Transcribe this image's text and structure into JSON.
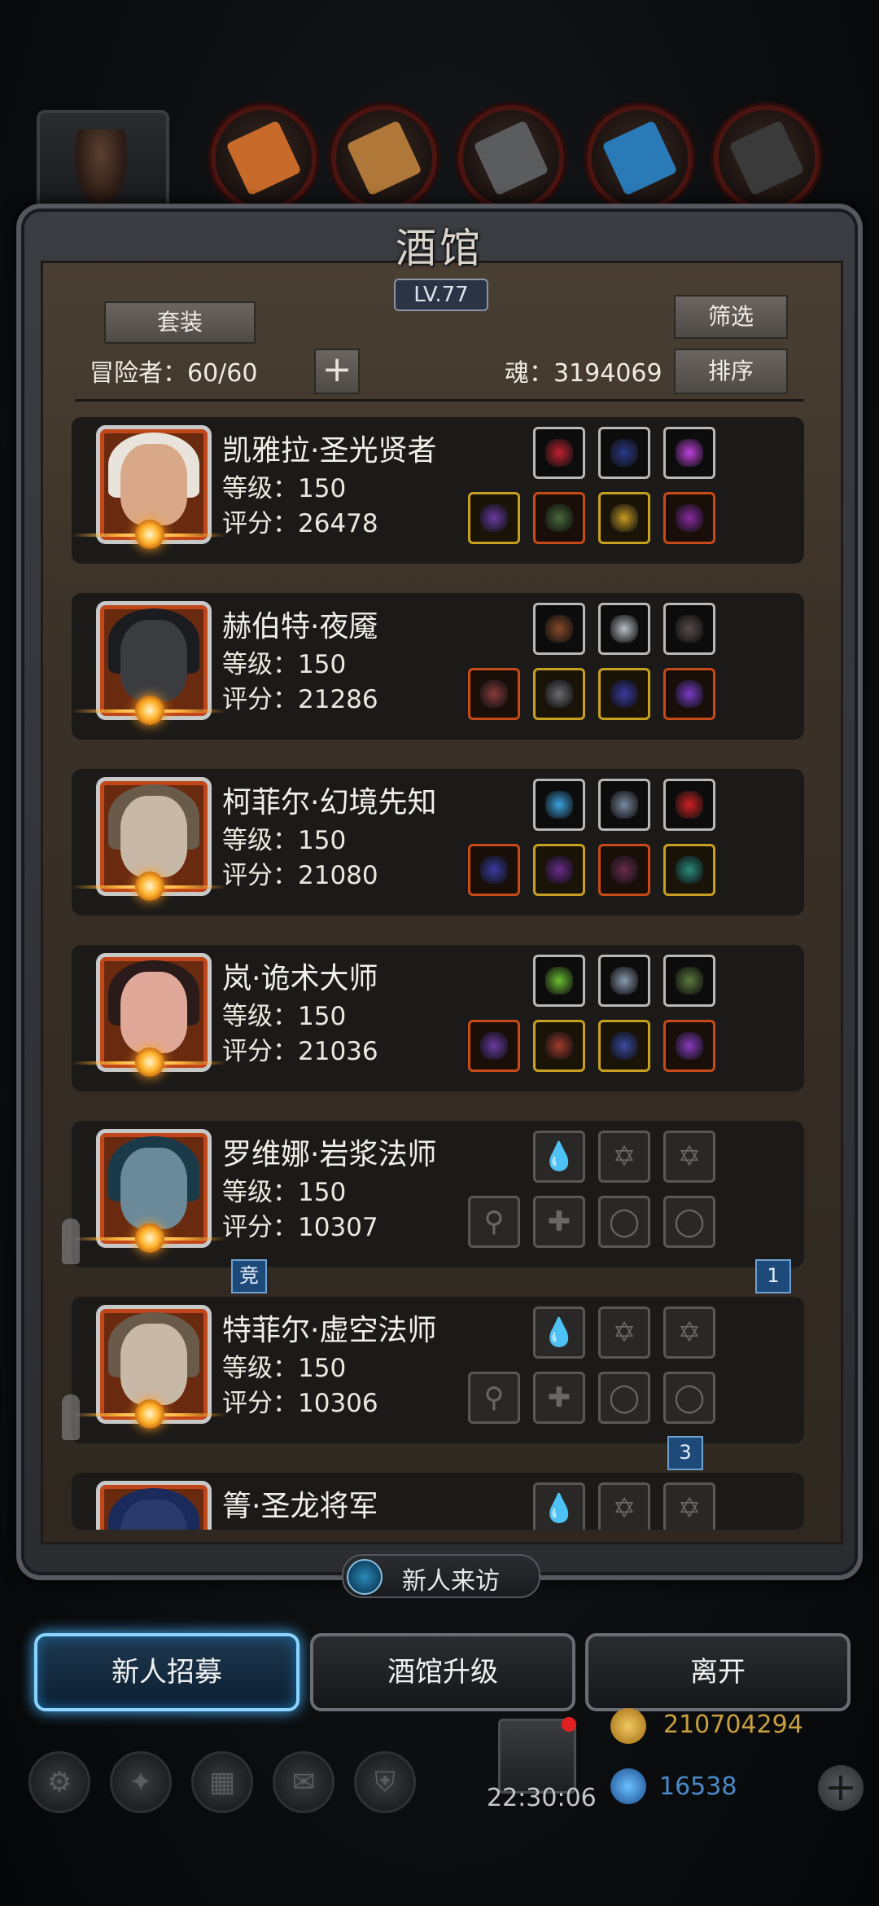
{
  "top_bar": {
    "icons": [
      {
        "name": "orange-ore-icon",
        "color": "#c86a2a"
      },
      {
        "name": "wood-plank-icon",
        "color": "#b07838"
      },
      {
        "name": "iron-bar-icon",
        "color": "#5a5c5e"
      },
      {
        "name": "blue-crystal-icon",
        "color": "#2a7ab8"
      },
      {
        "name": "black-ingot-icon",
        "color": "#3a3a3a"
      }
    ]
  },
  "tavern": {
    "title": "酒馆",
    "level": "LV.77",
    "set_button": "套装",
    "filter_button": "筛选",
    "sort_button": "排序",
    "adventurers_label": "冒险者：60/60",
    "soul_label": "魂：3194069"
  },
  "heroes": [
    {
      "name": "凯雅拉·圣光贤者",
      "level": "等级：150",
      "score": "评分：26478",
      "ghost": false,
      "top_slots": [
        {
          "style": "dark",
          "color": "#c02030"
        },
        {
          "style": "dark",
          "color": "#2a3a8a"
        },
        {
          "style": "dark",
          "color": "#c040e0"
        }
      ],
      "bottom_slots": [
        {
          "style": "gold",
          "color": "#6a3aa0"
        },
        {
          "style": "orange",
          "color": "#4a6a3a"
        },
        {
          "style": "gold",
          "color": "#c89a20"
        },
        {
          "style": "orange",
          "color": "#8a2aa0"
        }
      ],
      "portrait": {
        "skin": "#d8a888",
        "hood": "#e8e4dc"
      }
    },
    {
      "name": "赫伯特·夜魇",
      "level": "等级：150",
      "score": "评分：21286",
      "ghost": false,
      "top_slots": [
        {
          "style": "dark",
          "color": "#8a4a2a"
        },
        {
          "style": "dark",
          "color": "#b8c0c8"
        },
        {
          "style": "dark",
          "color": "#5a4a4a"
        }
      ],
      "bottom_slots": [
        {
          "style": "orange",
          "color": "#8a3a3a"
        },
        {
          "style": "gold",
          "color": "#6a6c70"
        },
        {
          "style": "gold",
          "color": "#3a3aa0"
        },
        {
          "style": "orange",
          "color": "#7a3ac8"
        }
      ],
      "portrait": {
        "skin": "#3a3c40",
        "hood": "#1a1c20"
      }
    },
    {
      "name": "柯菲尔·幻境先知",
      "level": "等级：150",
      "score": "评分：21080",
      "ghost": false,
      "top_slots": [
        {
          "style": "dark",
          "color": "#3aa0e0"
        },
        {
          "style": "dark",
          "color": "#7a8aa0"
        },
        {
          "style": "dark",
          "color": "#d02020"
        }
      ],
      "bottom_slots": [
        {
          "style": "orange",
          "color": "#3a3aa0"
        },
        {
          "style": "gold",
          "color": "#6a2a8a"
        },
        {
          "style": "orange",
          "color": "#6a2a4a"
        },
        {
          "style": "gold",
          "color": "#2a8a7a"
        }
      ],
      "portrait": {
        "skin": "#c8b8a8",
        "hood": "#6a5a4a"
      }
    },
    {
      "name": "岚·诡术大师",
      "level": "等级：150",
      "score": "评分：21036",
      "ghost": false,
      "top_slots": [
        {
          "style": "dark",
          "color": "#6ac030"
        },
        {
          "style": "dark",
          "color": "#8a9ab0"
        },
        {
          "style": "dark",
          "color": "#5a7a3a"
        }
      ],
      "bottom_slots": [
        {
          "style": "orange",
          "color": "#6a3aa0"
        },
        {
          "style": "gold",
          "color": "#a03a2a"
        },
        {
          "style": "gold",
          "color": "#3a4aa0"
        },
        {
          "style": "orange",
          "color": "#8a3ac0"
        }
      ],
      "portrait": {
        "skin": "#e0a898",
        "hood": "#2a1a1a"
      }
    },
    {
      "name": "罗维娜·岩浆法师",
      "level": "等级：150",
      "score": "评分：10307",
      "ghost": true,
      "top_slots": [
        {
          "style": "empty",
          "glyph": "💧"
        },
        {
          "style": "empty",
          "glyph": "✡"
        },
        {
          "style": "empty",
          "glyph": "✡"
        }
      ],
      "bottom_slots": [
        {
          "style": "empty",
          "glyph": "⚲"
        },
        {
          "style": "empty",
          "glyph": "✚"
        },
        {
          "style": "empty",
          "glyph": "◯"
        },
        {
          "style": "empty",
          "glyph": "◯"
        }
      ],
      "portrait": {
        "skin": "#6a8a9a",
        "hood": "#1a3a4a"
      }
    },
    {
      "name": "特菲尔·虚空法师",
      "level": "等级：150",
      "score": "评分：10306",
      "ghost": true,
      "top_slots": [
        {
          "style": "empty",
          "glyph": "💧"
        },
        {
          "style": "empty",
          "glyph": "✡"
        },
        {
          "style": "empty",
          "glyph": "✡"
        }
      ],
      "bottom_slots": [
        {
          "style": "empty",
          "glyph": "⚲"
        },
        {
          "style": "empty",
          "glyph": "✚"
        },
        {
          "style": "empty",
          "glyph": "◯"
        },
        {
          "style": "empty",
          "glyph": "◯"
        }
      ],
      "portrait": {
        "skin": "#c8b8a8",
        "hood": "#6a5a4a"
      }
    },
    {
      "name": "箐·圣龙将军",
      "level": "",
      "score": "",
      "ghost": false,
      "top_slots": [
        {
          "style": "empty",
          "glyph": "💧"
        },
        {
          "style": "empty",
          "glyph": "✡"
        },
        {
          "style": "empty",
          "glyph": "✡"
        }
      ],
      "bottom_slots": [],
      "portrait": {
        "skin": "#2a3a6a",
        "hood": "#1a2a5a"
      }
    }
  ],
  "tags": {
    "competition": "竞",
    "rank_1": "1",
    "rank_3": "3"
  },
  "bottom": {
    "new_visitor": "新人来访",
    "recruit": "新人招募",
    "upgrade": "酒馆升级",
    "leave": "离开",
    "gold_amount": "210704294",
    "gem_amount": "16538",
    "time": "22:30:06"
  }
}
